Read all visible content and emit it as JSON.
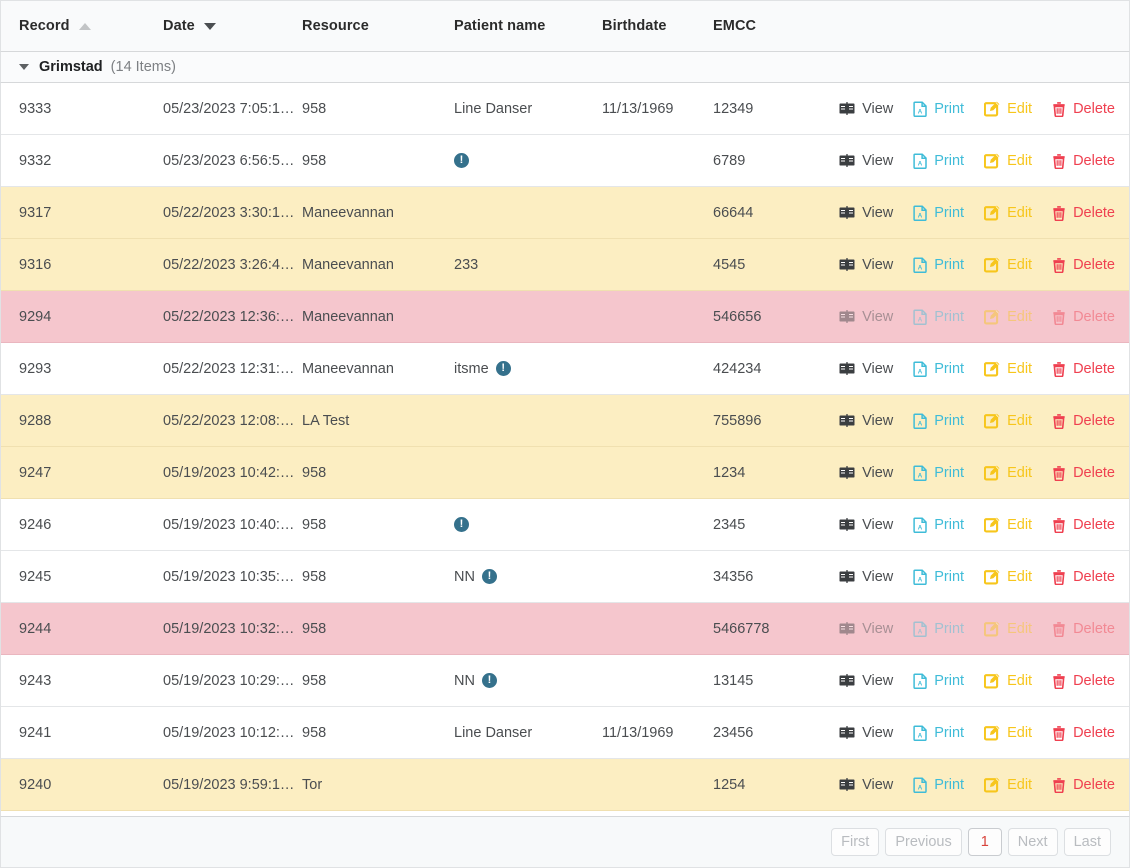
{
  "columns": [
    {
      "label": "Record",
      "sort": "asc-inactive"
    },
    {
      "label": "Date",
      "sort": "desc-active"
    },
    {
      "label": "Resource",
      "sort": "none"
    },
    {
      "label": "Patient name",
      "sort": "none"
    },
    {
      "label": "Birthdate",
      "sort": "none"
    },
    {
      "label": "EMCC",
      "sort": "none"
    }
  ],
  "group": {
    "name": "Grimstad",
    "count_label": "(14 Items)",
    "caret_icon": "chevron-down-icon"
  },
  "actions": {
    "view": {
      "label": "View",
      "icon": "book-icon",
      "color": "#4a4d50"
    },
    "print": {
      "label": "Print",
      "icon": "pdf-icon",
      "color": "#3fbcd8"
    },
    "edit": {
      "label": "Edit",
      "icon": "pencil-square-icon",
      "color": "#f7c61c"
    },
    "delete": {
      "label": "Delete",
      "icon": "trash-icon",
      "color": "#ef4050"
    }
  },
  "info_icon": {
    "glyph": "!",
    "name": "info-icon",
    "color": "#35718c"
  },
  "row_colors": {
    "normal": "#ffffff",
    "warn": "#fceec2",
    "danger": "#f5c6cd"
  },
  "rows": [
    {
      "record": "9333",
      "date": "05/23/2023 7:05:1…",
      "resource": "958",
      "patient": "Line Danser",
      "info": false,
      "birthdate": "11/13/1969",
      "emcc": "12349",
      "state": "normal"
    },
    {
      "record": "9332",
      "date": "05/23/2023 6:56:5…",
      "resource": "958",
      "patient": "",
      "info": true,
      "birthdate": "",
      "emcc": "6789",
      "state": "normal"
    },
    {
      "record": "9317",
      "date": "05/22/2023 3:30:1…",
      "resource": "Maneevannan",
      "patient": "",
      "info": false,
      "birthdate": "",
      "emcc": "66644",
      "state": "warn"
    },
    {
      "record": "9316",
      "date": "05/22/2023 3:26:4…",
      "resource": "Maneevannan",
      "patient": "233",
      "info": false,
      "birthdate": "",
      "emcc": "4545",
      "state": "warn"
    },
    {
      "record": "9294",
      "date": "05/22/2023 12:36:…",
      "resource": "Maneevannan",
      "patient": "",
      "info": false,
      "birthdate": "",
      "emcc": "546656",
      "state": "danger"
    },
    {
      "record": "9293",
      "date": "05/22/2023 12:31:…",
      "resource": "Maneevannan",
      "patient": "itsme",
      "info": true,
      "birthdate": "",
      "emcc": "424234",
      "state": "normal"
    },
    {
      "record": "9288",
      "date": "05/22/2023 12:08:…",
      "resource": "LA Test",
      "patient": "",
      "info": false,
      "birthdate": "",
      "emcc": "755896",
      "state": "warn"
    },
    {
      "record": "9247",
      "date": "05/19/2023 10:42:…",
      "resource": "958",
      "patient": "",
      "info": false,
      "birthdate": "",
      "emcc": "1234",
      "state": "warn"
    },
    {
      "record": "9246",
      "date": "05/19/2023 10:40:…",
      "resource": "958",
      "patient": "",
      "info": true,
      "birthdate": "",
      "emcc": "2345",
      "state": "normal"
    },
    {
      "record": "9245",
      "date": "05/19/2023 10:35:…",
      "resource": "958",
      "patient": "NN",
      "info": true,
      "birthdate": "",
      "emcc": "34356",
      "state": "normal"
    },
    {
      "record": "9244",
      "date": "05/19/2023 10:32:…",
      "resource": "958",
      "patient": "",
      "info": false,
      "birthdate": "",
      "emcc": "5466778",
      "state": "danger"
    },
    {
      "record": "9243",
      "date": "05/19/2023 10:29:…",
      "resource": "958",
      "patient": "NN",
      "info": true,
      "birthdate": "",
      "emcc": "13145",
      "state": "normal"
    },
    {
      "record": "9241",
      "date": "05/19/2023 10:12:…",
      "resource": "958",
      "patient": "Line Danser",
      "info": false,
      "birthdate": "11/13/1969",
      "emcc": "23456",
      "state": "normal"
    },
    {
      "record": "9240",
      "date": "05/19/2023 9:59:1…",
      "resource": "Tor",
      "patient": "",
      "info": false,
      "birthdate": "",
      "emcc": "1254",
      "state": "warn"
    }
  ],
  "pagination": {
    "first": "First",
    "previous": "Previous",
    "current": "1",
    "next": "Next",
    "last": "Last"
  }
}
